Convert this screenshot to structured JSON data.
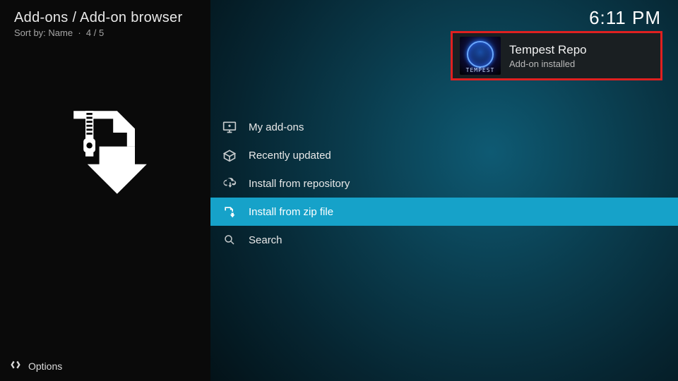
{
  "header": {
    "breadcrumb": "Add-ons / Add-on browser",
    "sort_label": "Sort by: Name",
    "position": "4 / 5",
    "clock": "6:11 PM"
  },
  "sidebar": {
    "footer_label": "Options"
  },
  "menu": {
    "items": [
      {
        "label": "My add-ons",
        "selected": false
      },
      {
        "label": "Recently updated",
        "selected": false
      },
      {
        "label": "Install from repository",
        "selected": false
      },
      {
        "label": "Install from zip file",
        "selected": true
      },
      {
        "label": "Search",
        "selected": false
      }
    ]
  },
  "notification": {
    "title": "Tempest Repo",
    "subtitle": "Add-on installed",
    "thumb_label": "TEMPEST"
  }
}
